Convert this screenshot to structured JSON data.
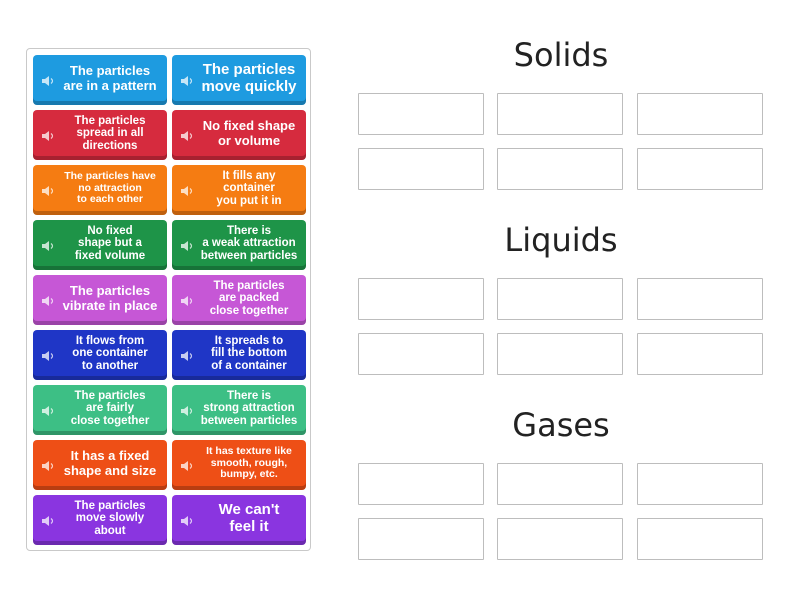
{
  "tiles": [
    {
      "label": "The particles\nare in a pattern",
      "color": "#1E9BE0",
      "size": "s-md"
    },
    {
      "label": "The particles\nmove quickly",
      "color": "#1E9BE0",
      "size": "s-big"
    },
    {
      "label": "The particles\nspread in all\ndirections",
      "color": "#D62B3E",
      "size": "s-sm"
    },
    {
      "label": "No fixed shape\nor volume",
      "color": "#D62B3E",
      "size": "s-md"
    },
    {
      "label": "The particles have\nno attraction\nto each other",
      "color": "#F57C12",
      "size": "s-xs"
    },
    {
      "label": "It fills any\ncontainer\nyou put it in",
      "color": "#F57C12",
      "size": "s-sm"
    },
    {
      "label": "No fixed\nshape but a\nfixed volume",
      "color": "#1E9448",
      "size": "s-sm"
    },
    {
      "label": "There is\na weak attraction\nbetween particles",
      "color": "#1E9448",
      "size": "s-sm"
    },
    {
      "label": "The particles\nvibrate in place",
      "color": "#C657D6",
      "size": "s-md"
    },
    {
      "label": "The particles\nare packed\nclose together",
      "color": "#C657D6",
      "size": "s-sm"
    },
    {
      "label": "It flows from\none container\nto another",
      "color": "#1F36C6",
      "size": "s-sm"
    },
    {
      "label": "It spreads to\nfill the bottom\nof a container",
      "color": "#1F36C6",
      "size": "s-sm"
    },
    {
      "label": "The particles\nare fairly\nclose together",
      "color": "#3DBF85",
      "size": "s-sm"
    },
    {
      "label": "There is\nstrong attraction\nbetween particles",
      "color": "#3DBF85",
      "size": "s-sm"
    },
    {
      "label": "It has a fixed\nshape and size",
      "color": "#EE4F16",
      "size": "s-md"
    },
    {
      "label": "It has texture like\nsmooth, rough,\nbumpy, etc.",
      "color": "#EE4F16",
      "size": "s-xs"
    },
    {
      "label": "The particles\nmove slowly\nabout",
      "color": "#8A35E0",
      "size": "s-sm"
    },
    {
      "label": "We can't\nfeel it",
      "color": "#8A35E0",
      "size": "s-big"
    }
  ],
  "icons": {
    "tile_audio": "speaker-icon"
  },
  "categories": [
    {
      "title": "Solids",
      "slots": 6
    },
    {
      "title": "Liquids",
      "slots": 6
    },
    {
      "title": "Gases",
      "slots": 6
    }
  ]
}
